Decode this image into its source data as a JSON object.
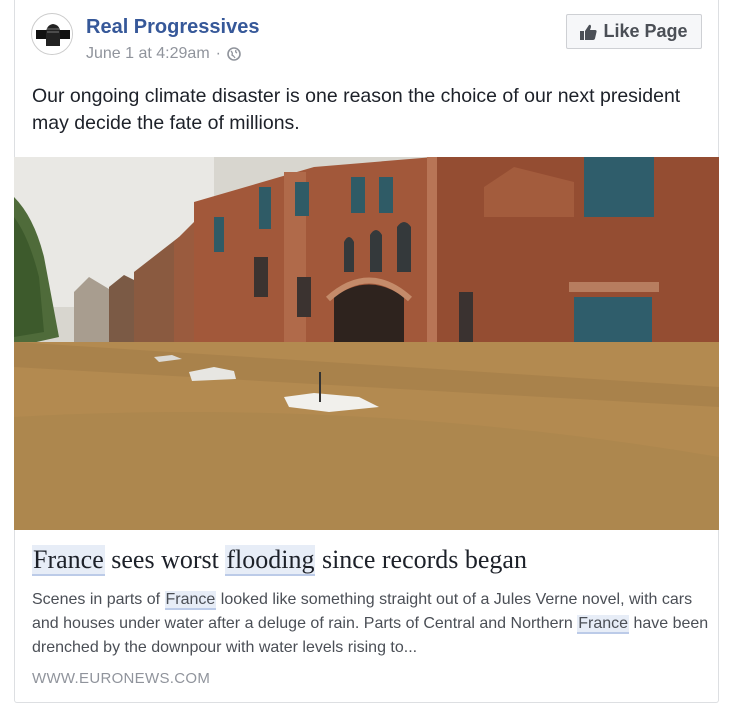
{
  "post": {
    "page_name": "Real Progressives",
    "timestamp": "June 1 at 4:29am",
    "separator": "·",
    "privacy_icon": "globe-icon",
    "like_button_label": "Like Page",
    "text": "Our ongoing climate disaster is one reason the choice of our next president may decide the fate of millions."
  },
  "link": {
    "title_parts": [
      "France",
      " sees worst ",
      "flooding",
      " since records began"
    ],
    "desc_parts": [
      "Scenes in parts of ",
      "France",
      " looked like something straight out of a Jules Verne novel, with cars and houses under water after a deluge of rain. Parts of Central and Northern ",
      "France",
      " have been drenched by the downpour with water levels rising to..."
    ],
    "source": "WWW.EURONEWS.COM"
  },
  "colors": {
    "page_name": "#365899",
    "meta": "#90949c",
    "highlight": "#e7edf7"
  }
}
